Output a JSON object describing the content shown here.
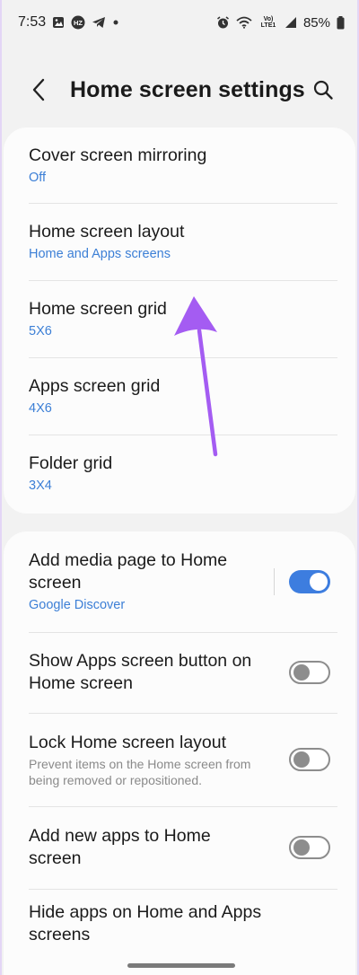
{
  "status_bar": {
    "time": "7:53",
    "left_icons": [
      "gallery-icon",
      "hz-badge-icon",
      "telegram-icon",
      "dot-icon"
    ],
    "right_icons": [
      "alarm-icon",
      "wifi-icon",
      "volte-lte-icon",
      "signal-icon",
      "battery-icon"
    ],
    "volte_label": "Vo) LTE1",
    "battery_pct": "85%"
  },
  "header": {
    "title": "Home screen settings",
    "back_icon": "back-arrow-icon",
    "search_icon": "search-icon"
  },
  "group1": {
    "items": [
      {
        "title": "Cover screen mirroring",
        "sub": "Off"
      },
      {
        "title": "Home screen layout",
        "sub": "Home and Apps screens"
      },
      {
        "title": "Home screen grid",
        "sub": "5X6"
      },
      {
        "title": "Apps screen grid",
        "sub": "4X6"
      },
      {
        "title": "Folder grid",
        "sub": "3X4"
      }
    ]
  },
  "group2": {
    "items": [
      {
        "title": "Add media page to Home screen",
        "sub": "Google Discover",
        "toggle": true
      },
      {
        "title": "Show Apps screen button on Home screen",
        "toggle": false
      },
      {
        "title": "Lock Home screen layout",
        "desc": "Prevent items on the Home screen from being removed or repositioned.",
        "toggle": false
      },
      {
        "title": "Add new apps to Home screen",
        "toggle": false
      },
      {
        "title": "Hide apps on Home and Apps screens"
      }
    ]
  },
  "colors": {
    "accent": "#3d7ddf",
    "link_sub": "#3c7fd6",
    "annotation_arrow": "#a45cf2",
    "background": "#f2f2f2",
    "card": "#fcfcfc"
  }
}
